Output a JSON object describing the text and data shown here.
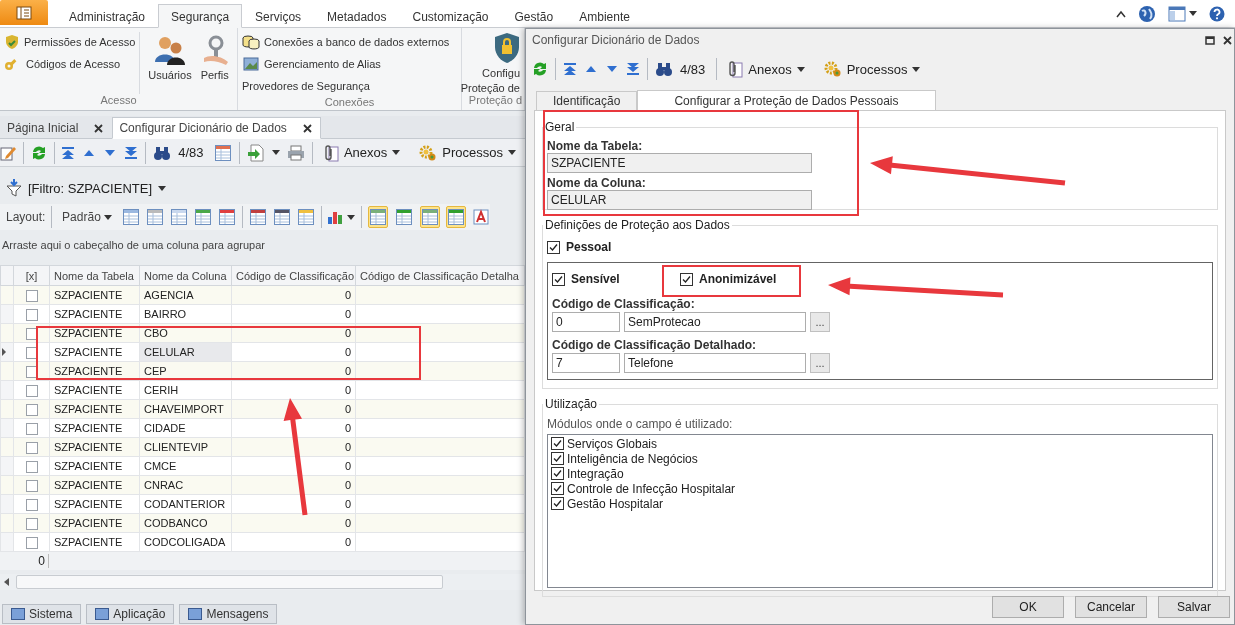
{
  "ribbon": {
    "tabs": [
      {
        "label": "Administração",
        "selected": false
      },
      {
        "label": "Segurança",
        "selected": true
      },
      {
        "label": "Serviços",
        "selected": false
      },
      {
        "label": "Metadados",
        "selected": false
      },
      {
        "label": "Customização",
        "selected": false
      },
      {
        "label": "Gestão",
        "selected": false
      },
      {
        "label": "Ambiente",
        "selected": false
      }
    ],
    "groups": [
      {
        "label": "Acesso",
        "items": [
          {
            "kind": "small",
            "label": "Permissões de Acesso"
          },
          {
            "kind": "small",
            "label": "Códigos de Acesso"
          },
          {
            "kind": "large",
            "lines": [
              "Usuários"
            ]
          },
          {
            "kind": "large",
            "lines": [
              "Perfis"
            ]
          }
        ]
      },
      {
        "label": "Conexões",
        "items": [
          {
            "kind": "small",
            "label": "Conexões a banco de dados externos"
          },
          {
            "kind": "small",
            "label": "Gerenciamento de Alias"
          },
          {
            "kind": "small",
            "label": "Provedores de Segurança"
          }
        ]
      },
      {
        "label": "Proteção d",
        "items": [
          {
            "kind": "large",
            "lines": [
              "Configu",
              "Proteção de"
            ]
          }
        ]
      }
    ]
  },
  "documents": {
    "tabs": [
      {
        "label": "Página Inicial",
        "selected": false
      },
      {
        "label": "Configurar Dicionário de Dados",
        "selected": true
      }
    ]
  },
  "toolbar": {
    "counter": "4/83",
    "menus": [
      "Anexos",
      "Processos"
    ]
  },
  "filter": {
    "label": "[Filtro: SZPACIENTE]"
  },
  "layout_bar": {
    "label": "Layout:",
    "preset": "Padrão",
    "view_toggles": [
      {
        "selected": true
      },
      {
        "selected": false
      },
      {
        "selected": true
      },
      {
        "selected": true
      },
      {
        "selected": false
      }
    ]
  },
  "group_hint": "Arraste aqui o cabeçalho de uma coluna para agrupar",
  "grid": {
    "columns": [
      "[x]",
      "Nome da Tabela",
      "Nome da Coluna",
      "Código de Classificação",
      "Código de Classificação Detalha"
    ],
    "rows": [
      {
        "table": "SZPACIENTE",
        "column": "AGENCIA",
        "code": "0",
        "checked": false,
        "selected": false
      },
      {
        "table": "SZPACIENTE",
        "column": "BAIRRO",
        "code": "0",
        "checked": false,
        "selected": false
      },
      {
        "table": "SZPACIENTE",
        "column": "CBO",
        "code": "0",
        "checked": false,
        "selected": false
      },
      {
        "table": "SZPACIENTE",
        "column": "CELULAR",
        "code": "0",
        "checked": false,
        "selected": true
      },
      {
        "table": "SZPACIENTE",
        "column": "CEP",
        "code": "0",
        "checked": false,
        "selected": false
      },
      {
        "table": "SZPACIENTE",
        "column": "CERIH",
        "code": "0",
        "checked": false,
        "selected": false
      },
      {
        "table": "SZPACIENTE",
        "column": "CHAVEIMPORT",
        "code": "0",
        "checked": false,
        "selected": false
      },
      {
        "table": "SZPACIENTE",
        "column": "CIDADE",
        "code": "0",
        "checked": false,
        "selected": false
      },
      {
        "table": "SZPACIENTE",
        "column": "CLIENTEVIP",
        "code": "0",
        "checked": false,
        "selected": false
      },
      {
        "table": "SZPACIENTE",
        "column": "CMCE",
        "code": "0",
        "checked": false,
        "selected": false
      },
      {
        "table": "SZPACIENTE",
        "column": "CNRAC",
        "code": "0",
        "checked": false,
        "selected": false
      },
      {
        "table": "SZPACIENTE",
        "column": "CODANTERIOR",
        "code": "0",
        "checked": false,
        "selected": false
      },
      {
        "table": "SZPACIENTE",
        "column": "CODBANCO",
        "code": "0",
        "checked": false,
        "selected": false
      },
      {
        "table": "SZPACIENTE",
        "column": "CODCOLIGADA",
        "code": "0",
        "checked": false,
        "selected": false
      }
    ],
    "footer_total": "0"
  },
  "bottom_tabs": [
    "Sistema",
    "Aplicação",
    "Mensagens"
  ],
  "dialog": {
    "title": "Configurar Dicionário de Dados",
    "toolbar": {
      "counter": "4/83",
      "menus": [
        "Anexos",
        "Processos"
      ]
    },
    "tabs": [
      {
        "label": "Identificação",
        "selected": false
      },
      {
        "label": "Configurar a Proteção de Dados Pessoais",
        "selected": true
      }
    ],
    "general": {
      "title": "Geral",
      "fields": [
        {
          "label": "Nome da Tabela:",
          "value": "SZPACIENTE"
        },
        {
          "label": "Nome da Coluna:",
          "value": "CELULAR"
        }
      ]
    },
    "protection": {
      "title": "Definições de Proteção aos Dados",
      "personal": {
        "label": "Pessoal",
        "checked": true
      },
      "flags": [
        {
          "label": "Sensível",
          "checked": true
        },
        {
          "label": "Anonimizável",
          "checked": true
        }
      ],
      "codes": [
        {
          "label": "Código de Classificação:",
          "code": "0",
          "name": "SemProtecao",
          "lookup": "..."
        },
        {
          "label": "Código de Classificação Detalhado:",
          "code": "7",
          "name": "Telefone",
          "lookup": "..."
        }
      ]
    },
    "usage": {
      "title": "Utilização",
      "caption": "Módulos onde o campo é utilizado:",
      "modules": [
        {
          "label": "Serviços Globais",
          "checked": true
        },
        {
          "label": "Inteligência de Negócios",
          "checked": true
        },
        {
          "label": "Integração",
          "checked": true
        },
        {
          "label": "Controle de Infecção Hospitalar",
          "checked": true
        },
        {
          "label": "Gestão Hospitalar",
          "checked": true
        }
      ]
    },
    "buttons": [
      "OK",
      "Cancelar",
      "Salvar"
    ]
  }
}
